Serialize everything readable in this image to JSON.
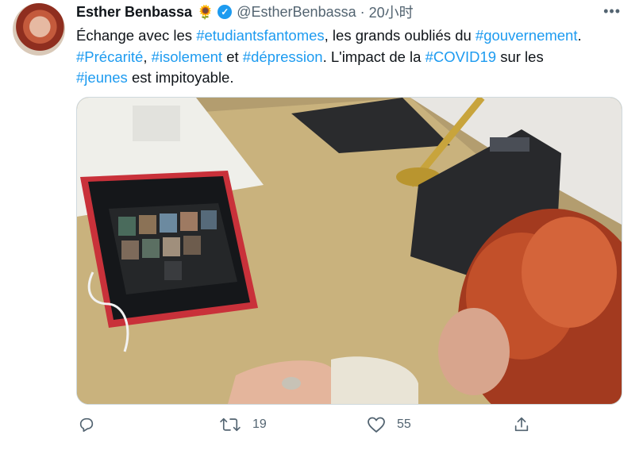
{
  "author": {
    "name": "Esther Benbassa",
    "emoji": "🌻",
    "handle": "@EstherBenbassa",
    "separator": "·",
    "time": "20小时"
  },
  "tweet": {
    "lines": [
      [
        {
          "text": "Échange avec les ",
          "type": "text"
        },
        {
          "text": "#etudiantsfantomes",
          "type": "hashtag"
        },
        {
          "text": ", les grands oubliés du ",
          "type": "text"
        },
        {
          "text": "#gouvernement",
          "type": "hashtag"
        },
        {
          "text": ".",
          "type": "text"
        }
      ],
      [
        {
          "text": "#Précarité",
          "type": "hashtag"
        },
        {
          "text": ", ",
          "type": "text"
        },
        {
          "text": "#isolement",
          "type": "hashtag"
        },
        {
          "text": " et ",
          "type": "text"
        },
        {
          "text": "#dépression",
          "type": "hashtag"
        },
        {
          "text": ". L'impact de la ",
          "type": "text"
        },
        {
          "text": "#COVID19",
          "type": "hashtag"
        },
        {
          "text": " sur les",
          "type": "text"
        }
      ],
      [
        {
          "text": "#jeunes",
          "type": "hashtag"
        },
        {
          "text": " est impitoyable.",
          "type": "text"
        }
      ]
    ]
  },
  "media": {
    "description_icon": "photo-of-woman-on-video-call-with-tablet"
  },
  "actions": {
    "reply_count": "",
    "retweet_count": "19",
    "like_count": "55"
  },
  "colors": {
    "accent": "#1d9bf0",
    "secondary_text": "#536471",
    "border": "#cfd9de"
  }
}
